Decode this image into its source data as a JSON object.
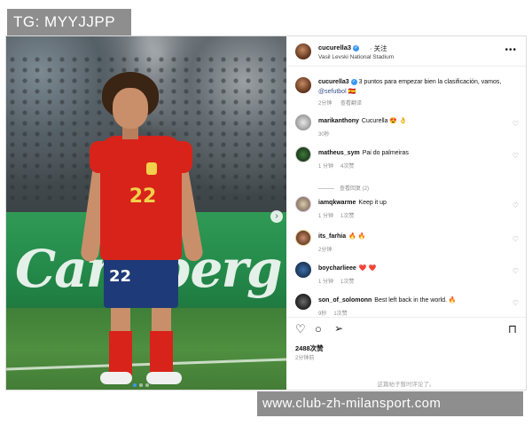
{
  "watermarks": {
    "tg": "TG: MYYJJPP",
    "site": "www.club-zh-milansport.com"
  },
  "photo": {
    "jersey_number": "22",
    "board_text": "Carlsberg"
  },
  "header": {
    "username": "cucurella3",
    "follow_label": "· 关注",
    "location": "Vasil Levski National Stadium"
  },
  "caption": {
    "username": "cucurella3",
    "text": "3 puntos para empezar bien la clasificación, vamos,",
    "mention": "@sefutbol",
    "mention_suffix": "🇪🇸",
    "time": "2分钟",
    "translate": "查看翻译"
  },
  "comments": [
    {
      "user": "marikanthony",
      "text": "Cucurella 😍 👌",
      "time": "30秒",
      "likes": ""
    },
    {
      "user": "matheus_sym",
      "text": "Pai do palmeiras",
      "time": "1 分钟",
      "likes": "4次赞"
    },
    {
      "user": "iamqkwarme",
      "text": "Keep it up",
      "time": "1 分钟",
      "likes": "1次赞"
    },
    {
      "user": "its_farhia",
      "text": "🔥 🔥",
      "time": "2分钟",
      "likes": ""
    },
    {
      "user": "boycharlieee",
      "text": "❤️ ❤️",
      "time": "1 分钟",
      "likes": "1次赞"
    },
    {
      "user": "son_of_solomonn",
      "text": "Best left back in the world. 🔥",
      "time": "9秒",
      "likes": "1次赞"
    }
  ],
  "replies_label": "查看回复 (2)",
  "stats": {
    "likes": "2488次赞",
    "time": "2分钟前"
  },
  "comments_disabled": "这篇帖子暂时评论了。",
  "colors": {
    "jersey_red": "#d8231a",
    "shorts_blue": "#1e3a78",
    "link_blue": "#385185",
    "verified_blue": "#3897f0"
  }
}
